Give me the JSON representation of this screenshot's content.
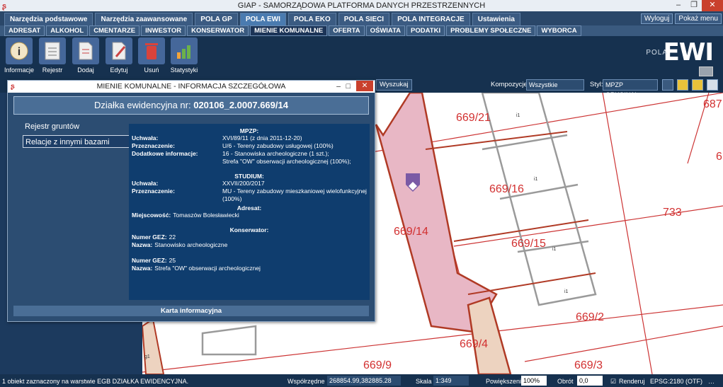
{
  "window": {
    "title": "GIAP - SAMORZĄDOWA PLATFORMA DANYCH PRZESTRZENNYCH"
  },
  "main_tabs": [
    "Narzędzia podstawowe",
    "Narzędzia zaawansowane",
    "POLA GP",
    "POLA EWI",
    "POLA EKO",
    "POLA SIECI",
    "POLA INTEGRACJE",
    "Ustawienia"
  ],
  "active_main_tab": "POLA EWI",
  "top_right": {
    "logout": "Wyloguj",
    "show_menu": "Pokaż menu"
  },
  "sub_tabs": [
    "ADRESAT",
    "ALKOHOL",
    "CMENTARZE",
    "INWESTOR",
    "KONSERWATOR",
    "MIENIE KOMUNALNE",
    "OFERTA",
    "OŚWIATA",
    "PODATKI",
    "PROBLEMY SPOŁECZNE",
    "WYBORCA"
  ],
  "active_sub_tab": "MIENIE KOMUNALNE",
  "ribbon": [
    {
      "label": "Informacje",
      "icon": "info-icon"
    },
    {
      "label": "Rejestr",
      "icon": "register-icon"
    },
    {
      "label": "Dodaj",
      "icon": "add-document-icon"
    },
    {
      "label": "Edytuj",
      "icon": "edit-icon"
    },
    {
      "label": "Usuń",
      "icon": "trash-icon"
    },
    {
      "label": "Statystyki",
      "icon": "statistics-icon"
    }
  ],
  "logo": {
    "small": "POLA",
    "big": "EWI"
  },
  "toolbar": {
    "search": "Wyszukaj",
    "compositions_label": "Kompozycje:",
    "compositions_value": "Wszystkie warstwy",
    "style_label": "Styl:",
    "style_value": "MPZP ORYGINAŁ"
  },
  "dialog": {
    "title": "MIENIE KOMUNALNE - INFORMACJA SZCZEGÓŁOWA",
    "header_prefix": "Działka ewidencyjna nr:",
    "header_number": "020106_2.0007.669/14",
    "left_items": [
      "Rejestr gruntów",
      "Relacje z innymi bazami"
    ],
    "mpzp": {
      "title": "MPZP:",
      "uchwala_k": "Uchwała:",
      "uchwala_v": "XVI/89/11 (z dnia 2011-12-20)",
      "przeznaczenie_k": "Przeznaczenie:",
      "przeznaczenie_v": "U/6 - Tereny zabudowy usługowej (100%)",
      "dodatkowe_k": "Dodatkowe informacje:",
      "dodatkowe_v1": "16 - Stanowiska archeologiczne (1 szt.);",
      "dodatkowe_v2": "Strefa \"OW\" obserwacji archeologicznej (100%);"
    },
    "studium": {
      "title": "STUDIUM:",
      "uchwala_k": "Uchwała:",
      "uchwala_v": "XXVII/200/2017",
      "przeznaczenie_k": "Przeznaczenie:",
      "przeznaczenie_v": "MU - Tereny zabudowy mieszkaniowej wielofunkcyjnej (100%)"
    },
    "adresat": {
      "title": "Adresat:",
      "miejscowosc_k": "Miejscowość:",
      "miejscowosc_v": "Tomaszów Bolesławiecki"
    },
    "konserwator": {
      "title": "Konserwator:",
      "gez1_k": "Numer GEZ:",
      "gez1_v": "22",
      "nazwa1_k": "Nazwa:",
      "nazwa1_v": "Stanowisko archeologiczne",
      "gez2_k": "Numer GEZ:",
      "gez2_v": "25",
      "nazwa2_k": "Nazwa:",
      "nazwa2_v": "Strefa \"OW\" obserwacji archeologicznej"
    },
    "bottom_button": "Karta informacyjna"
  },
  "map_labels": {
    "l1": "669/21",
    "l2": "669/16",
    "l3": "669/14",
    "l4": "669/15",
    "l5": "733",
    "l6": "669/2",
    "l7": "669/4",
    "l8": "669/9",
    "l9": "669/3",
    "l10": "687",
    "l11": "6",
    "i": "i1",
    "g": "g1"
  },
  "status": {
    "message": "1 obiekt zaznaczony na warstwie EGB DZIAŁKA EWIDENCYJNA.",
    "coords_label": "Współrzędne",
    "coords_value": "268854.99,382885.28",
    "scale_label": "Skala",
    "scale_value": "1:349",
    "zoom_label": "Powiększenie",
    "zoom_value": "100%",
    "rotation_label": "Obrót",
    "rotation_value": "0,0",
    "render_label": "Renderuj",
    "epsg": "EPSG:2180 (OTF)"
  }
}
